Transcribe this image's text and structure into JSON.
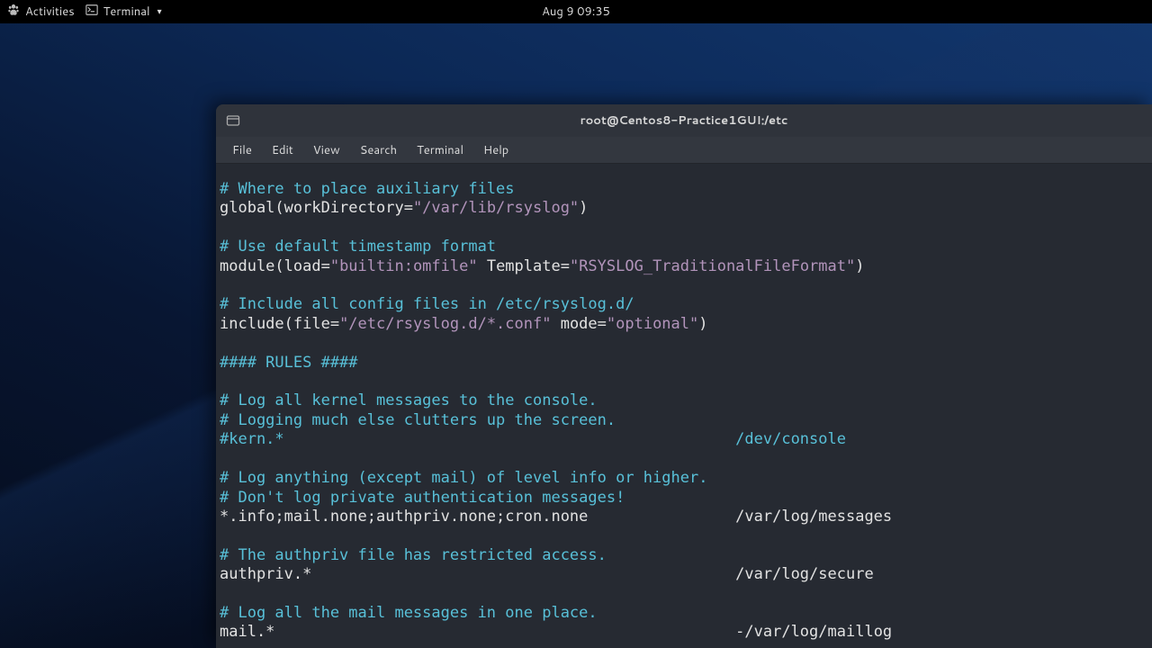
{
  "topbar": {
    "activities": "Activities",
    "app_label": "Terminal",
    "clock": "Aug 9  09:35"
  },
  "window": {
    "title": "root@Centos8-Practice1GUI:/etc"
  },
  "menubar": {
    "file": "File",
    "edit": "Edit",
    "view": "View",
    "search": "Search",
    "terminal": "Terminal",
    "help": "Help"
  },
  "content": {
    "l01": "# Where to place auxiliary files",
    "l02a": "global(workDirectory=",
    "l02b": "\"/var/lib/rsyslog\"",
    "l02c": ")",
    "l03": "",
    "l04": "# Use default timestamp format",
    "l05a": "module(load=",
    "l05b": "\"builtin:omfile\"",
    "l05c": " Template=",
    "l05d": "\"RSYSLOG_TraditionalFileFormat\"",
    "l05e": ")",
    "l06": "",
    "l07": "# Include all config files in /etc/rsyslog.d/",
    "l08a": "include(file=",
    "l08b": "\"/etc/rsyslog.d/*.conf\"",
    "l08c": " mode=",
    "l08d": "\"optional\"",
    "l08e": ")",
    "l09": "",
    "l10": "#### RULES ####",
    "l11": "",
    "l12": "# Log all kernel messages to the console.",
    "l13": "# Logging much else clutters up the screen.",
    "l14a": "#kern.*",
    "l14b": "                                                 /dev/console",
    "l15": "",
    "l16": "# Log anything (except mail) of level info or higher.",
    "l17": "# Don't log private authentication messages!",
    "l18a": "*.info;mail.none;authpriv.none;cron.none",
    "l18b": "                /var/log/messages",
    "l19": "",
    "l20": "# The authpriv file has restricted access.",
    "l21a": "authpriv.*",
    "l21b": "                                              /var/log/secure",
    "l22": "",
    "l23": "# Log all the mail messages in one place.",
    "l24a": "mail.*",
    "l24b": "                                                  -/var/log/maillog"
  }
}
